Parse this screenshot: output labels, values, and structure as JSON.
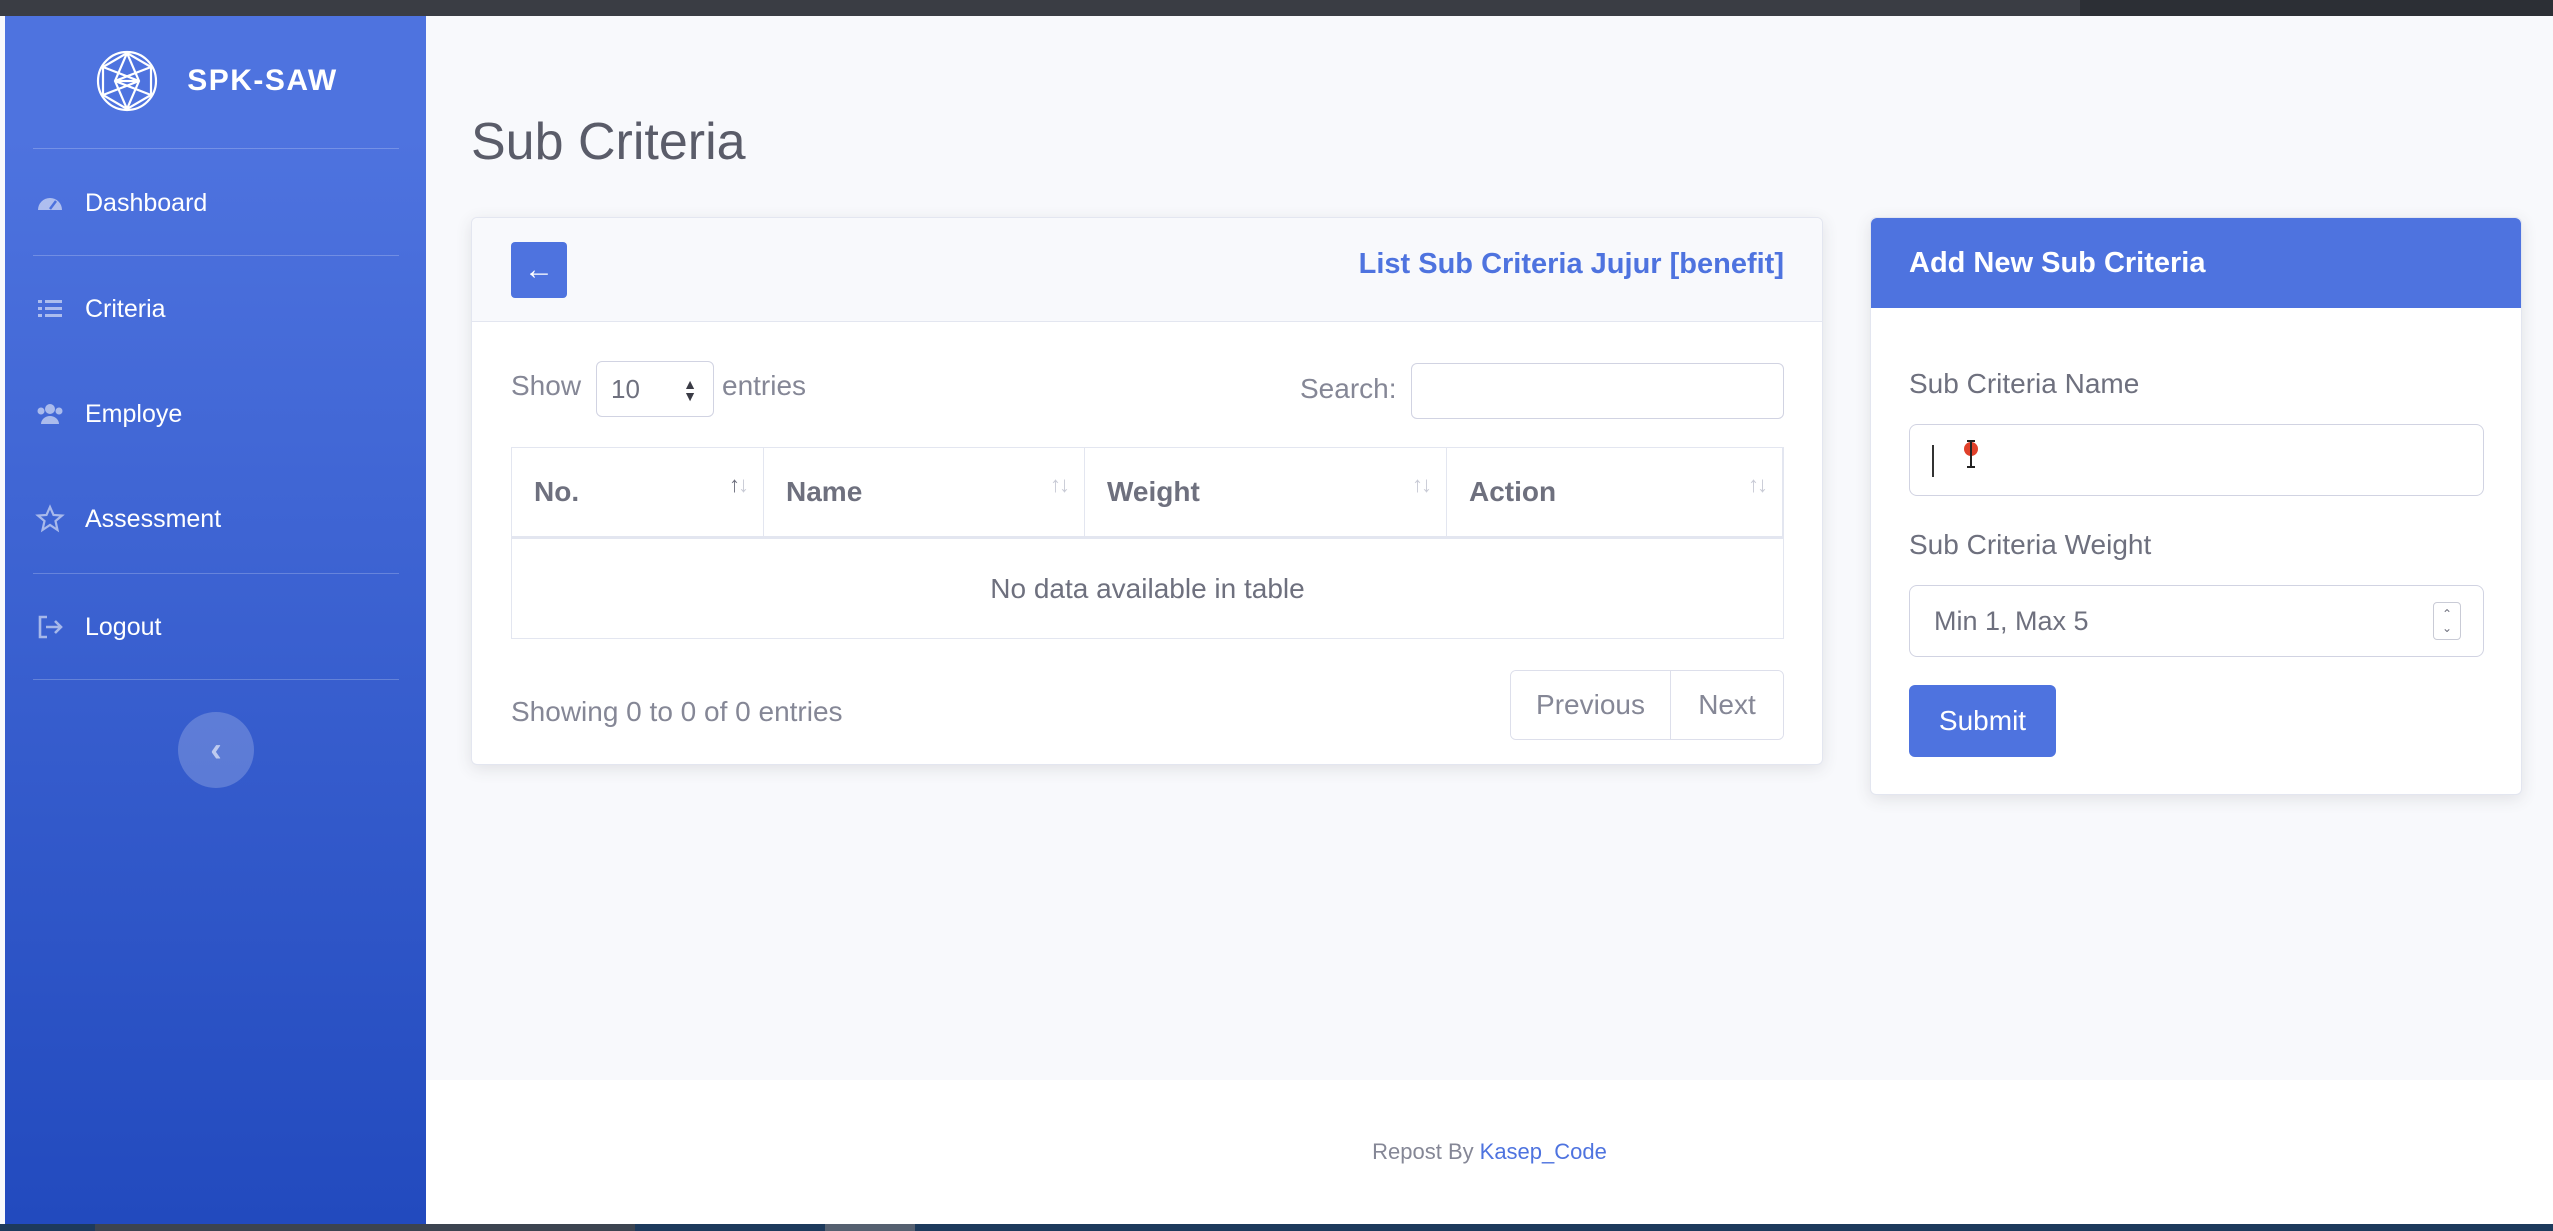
{
  "app": {
    "brand": "SPK-SAW"
  },
  "sidebar": {
    "items": [
      {
        "label": "Dashboard",
        "icon": "tachometer-icon"
      },
      {
        "label": "Criteria",
        "icon": "list-icon"
      },
      {
        "label": "Employe",
        "icon": "users-icon"
      },
      {
        "label": "Assessment",
        "icon": "star-icon"
      },
      {
        "label": "Logout",
        "icon": "sign-out-icon"
      }
    ],
    "toggle_glyph": "‹"
  },
  "page": {
    "title": "Sub Criteria"
  },
  "list_card": {
    "back_glyph": "←",
    "title": "List Sub Criteria Jujur [benefit]",
    "show_label": "Show",
    "entries_value": "10",
    "entries_label": "entries",
    "search_label": "Search:",
    "search_value": "",
    "columns": [
      "No.",
      "Name",
      "Weight",
      "Action"
    ],
    "empty_message": "No data available in table",
    "info": "Showing 0 to 0 of 0 entries",
    "pager": {
      "previous": "Previous",
      "next": "Next"
    }
  },
  "form_card": {
    "title": "Add New Sub Criteria",
    "name_label": "Sub Criteria Name",
    "name_value": "",
    "weight_label": "Sub Criteria Weight",
    "weight_placeholder": "Min 1, Max 5",
    "submit": "Submit"
  },
  "footer": {
    "text": "Repost By",
    "link": "Kasep_Code"
  },
  "colors": {
    "primary": "#4e73df",
    "sidebar_end": "#224abe",
    "text_muted": "#858796"
  }
}
